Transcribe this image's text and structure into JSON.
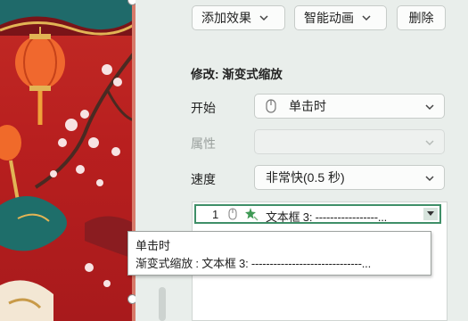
{
  "toolbar": {
    "add_effect_label": "添加效果",
    "smart_animation_label": "智能动画",
    "delete_label": "删除"
  },
  "effect_panel": {
    "heading": "修改: 渐变式缩放",
    "start": {
      "label": "开始",
      "value": "单击时",
      "icon": "mouse-icon"
    },
    "property": {
      "label": "属性",
      "value": ""
    },
    "speed": {
      "label": "速度",
      "value": "非常快(0.5 秒)"
    }
  },
  "animation_list": {
    "items": [
      {
        "number": "1",
        "icons": [
          "mouse-icon",
          "zoom-effect-icon"
        ],
        "text": "文本框 3: -----------------..."
      }
    ]
  },
  "tooltip": {
    "line1": "单击时",
    "line2": "渐变式缩放 : 文本框 3: ------------------------------..."
  },
  "colors": {
    "selection_border": "#3f8f68",
    "pane_background": "#e9eeeb",
    "slide_red": "#b81f1f"
  }
}
